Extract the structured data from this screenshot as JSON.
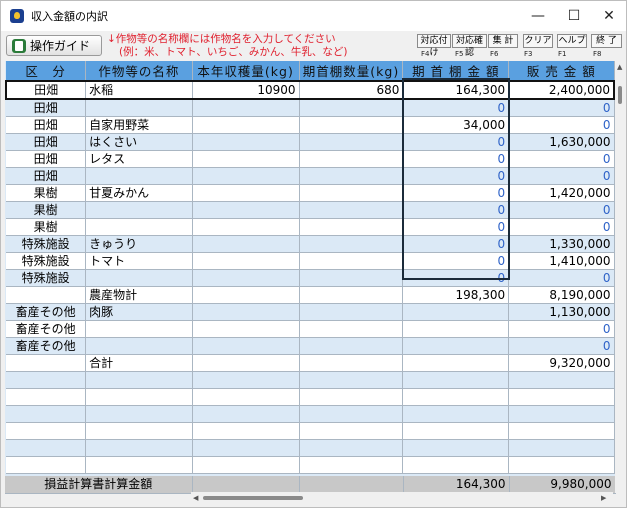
{
  "window": {
    "title": "収入金額の内訳"
  },
  "window_controls": {
    "minimize": "—",
    "maximize": "☐",
    "close": "✕"
  },
  "toolbar": {
    "guide_label": "操作ガイド",
    "notice_line1": "↓作物等の名称欄には作物名を入力してください",
    "notice_line2": "(例：米、トマト、いちご、みかん、牛乳、など)",
    "buttons": [
      {
        "label": "対応付け",
        "key": "F4"
      },
      {
        "label": "対応確認",
        "key": "F5"
      },
      {
        "label": "集 計",
        "key": "F6"
      },
      {
        "label": "クリア",
        "key": "F3"
      },
      {
        "label": "ヘルプ",
        "key": "F1"
      },
      {
        "label": "終 了",
        "key": "F8"
      }
    ]
  },
  "table": {
    "headers": [
      "区　分",
      "作物等の名称",
      "本年収穫量(kg)",
      "期首棚数量(kg)",
      "期 首 棚 金 額",
      "販 売 金 額"
    ],
    "rows": [
      [
        "田畑",
        "水稲",
        "10900",
        "680",
        "164,300",
        "2,400,000"
      ],
      [
        "田畑",
        "",
        "",
        "",
        "0",
        "0"
      ],
      [
        "田畑",
        "自家用野菜",
        "",
        "",
        "34,000",
        "0"
      ],
      [
        "田畑",
        "はくさい",
        "",
        "",
        "0",
        "1,630,000"
      ],
      [
        "田畑",
        "レタス",
        "",
        "",
        "0",
        "0"
      ],
      [
        "田畑",
        "",
        "",
        "",
        "0",
        "0"
      ],
      [
        "果樹",
        "甘夏みかん",
        "",
        "",
        "0",
        "1,420,000"
      ],
      [
        "果樹",
        "",
        "",
        "",
        "0",
        "0"
      ],
      [
        "果樹",
        "",
        "",
        "",
        "0",
        "0"
      ],
      [
        "特殊施設",
        "きゅうり",
        "",
        "",
        "0",
        "1,330,000"
      ],
      [
        "特殊施設",
        "トマト",
        "",
        "",
        "0",
        "1,410,000"
      ],
      [
        "特殊施設",
        "",
        "",
        "",
        "0",
        "0"
      ],
      [
        "",
        "農産物計",
        "",
        "",
        "198,300",
        "8,190,000"
      ],
      [
        "畜産その他",
        "肉豚",
        "",
        "",
        "",
        "1,130,000"
      ],
      [
        "畜産その他",
        "",
        "",
        "",
        "",
        "0"
      ],
      [
        "畜産その他",
        "",
        "",
        "",
        "",
        "0"
      ],
      [
        "",
        "合計",
        "",
        "",
        "",
        "9,320,000"
      ],
      [
        "",
        "",
        "",
        "",
        "",
        ""
      ],
      [
        "",
        "",
        "",
        "",
        "",
        ""
      ],
      [
        "",
        "",
        "",
        "",
        "",
        ""
      ],
      [
        "",
        "",
        "",
        "",
        "",
        ""
      ],
      [
        "",
        "",
        "",
        "",
        "",
        ""
      ],
      [
        "",
        "",
        "",
        "",
        "",
        ""
      ]
    ],
    "footer": [
      "損益計算書計算金額",
      "",
      "",
      "164,300",
      "9,980,000"
    ]
  }
}
